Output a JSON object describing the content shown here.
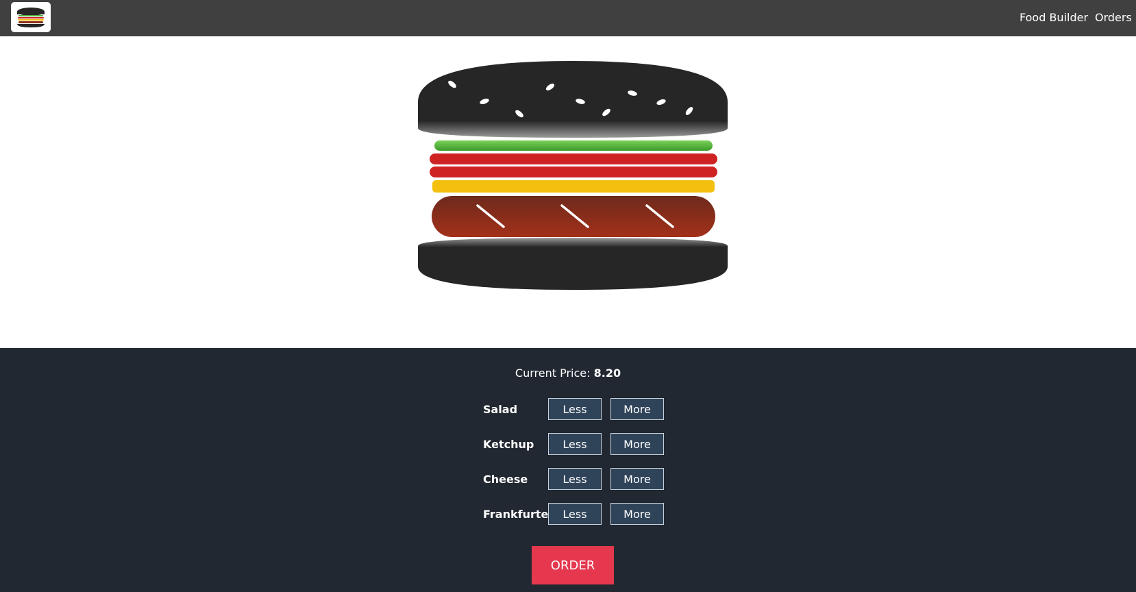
{
  "nav": {
    "logo_icon": "burger-logo-icon",
    "links": [
      "Food Builder",
      "Orders"
    ]
  },
  "price": {
    "label": "Current Price:",
    "value": "8.20"
  },
  "ingredients": [
    {
      "label": "Salad",
      "less": "Less",
      "more": "More"
    },
    {
      "label": "Ketchup",
      "less": "Less",
      "more": "More"
    },
    {
      "label": "Cheese",
      "less": "Less",
      "more": "More"
    },
    {
      "label": "Frankfurter",
      "less": "Less",
      "more": "More"
    }
  ],
  "order_button": "ORDER",
  "colors": {
    "topbar": "#404040",
    "controls_bg": "#222831",
    "control_button": "#2f4359",
    "order_button": "#e5384f",
    "bun": "#262626",
    "salad": "#4caf3a",
    "ketchup": "#cf2323",
    "cheese": "#f4c010",
    "frankfurter": "#8a2e18"
  }
}
